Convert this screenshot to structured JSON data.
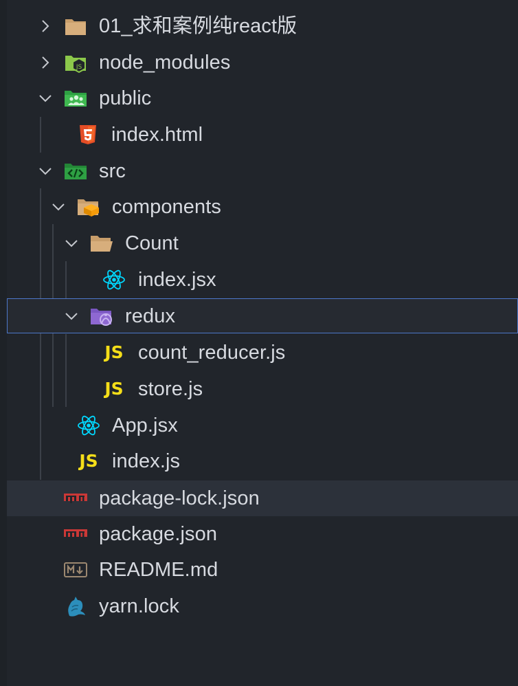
{
  "explorer": {
    "items": [
      {
        "label": "01_求和案例纯react版",
        "icon": "folder-icon",
        "state": "collapsed"
      },
      {
        "label": "node_modules",
        "icon": "node-folder-icon",
        "state": "collapsed"
      },
      {
        "label": "public",
        "icon": "public-folder-icon",
        "state": "expanded"
      },
      {
        "label": "index.html",
        "icon": "html5-icon"
      },
      {
        "label": "src",
        "icon": "src-folder-icon",
        "state": "expanded"
      },
      {
        "label": "components",
        "icon": "components-folder-icon",
        "state": "expanded"
      },
      {
        "label": "Count",
        "icon": "folder-open-icon",
        "state": "expanded"
      },
      {
        "label": "index.jsx",
        "icon": "react-icon"
      },
      {
        "label": "redux",
        "icon": "redux-folder-icon",
        "state": "expanded",
        "selected": true
      },
      {
        "label": "count_reducer.js",
        "icon": "js-icon",
        "icon_text": "JS"
      },
      {
        "label": "store.js",
        "icon": "js-icon",
        "icon_text": "JS"
      },
      {
        "label": "App.jsx",
        "icon": "react-icon"
      },
      {
        "label": "index.js",
        "icon": "js-icon",
        "icon_text": "JS"
      },
      {
        "label": "package-lock.json",
        "icon": "npm-icon",
        "hovered": true
      },
      {
        "label": "package.json",
        "icon": "npm-icon"
      },
      {
        "label": "README.md",
        "icon": "markdown-icon"
      },
      {
        "label": "yarn.lock",
        "icon": "yarn-icon"
      }
    ]
  },
  "colors": {
    "background": "#21252b",
    "text": "#d7dae0",
    "selection_border": "#4d78cc",
    "hover": "#2c313a",
    "folder": "#c89e6b",
    "html5": "#e44d26",
    "react": "#00d8ff",
    "js": "#f5de19",
    "npm": "#cb3837",
    "node": "#8cc84b",
    "public": "#3fb950",
    "redux": "#8e68d2",
    "yarn": "#2c8ebb"
  }
}
